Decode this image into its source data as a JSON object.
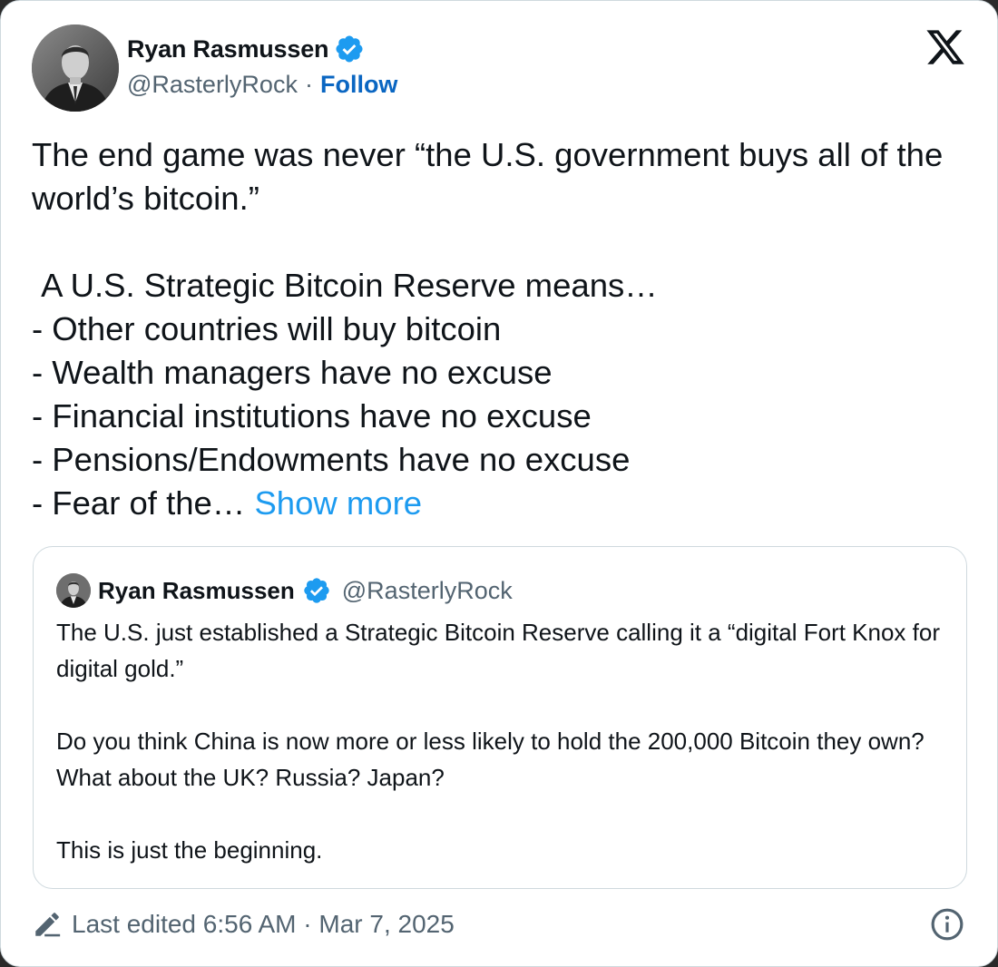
{
  "author": {
    "name": "Ryan Rasmussen",
    "handle": "@RasterlyRock",
    "separator": "·",
    "follow_label": "Follow",
    "verified": true
  },
  "platform_icon": "x-logo-icon",
  "tweet": {
    "text": "The end game was never “the U.S. government buys all of the world’s bitcoin.”\n\n A U.S. Strategic Bitcoin Reserve means…\n- Other countries will buy bitcoin\n- Wealth managers have no excuse\n- Financial institutions have no excuse\n- Pensions/Endowments have no excuse\n- Fear of the… ",
    "show_more_label": "Show more"
  },
  "quoted_tweet": {
    "name": "Ryan Rasmussen",
    "handle": "@RasterlyRock",
    "text": "The U.S. just established a Strategic Bitcoin Reserve calling it a “digital Fort Knox for digital gold.”\n\nDo you think China is now more or less likely to hold the 200,000 Bitcoin they own? What about the UK? Russia? Japan?\n\nThis is just the beginning."
  },
  "footer": {
    "edited_text": "Last edited 6:56 AM · Mar 7, 2025",
    "edit_icon": "pencil-icon",
    "info_icon": "info-icon"
  },
  "colors": {
    "link_blue": "#1d9bf0",
    "follow_blue": "#0a66c2",
    "verified_blue": "#1d9bf0",
    "secondary_text": "#536471",
    "border": "#cfd9de"
  }
}
